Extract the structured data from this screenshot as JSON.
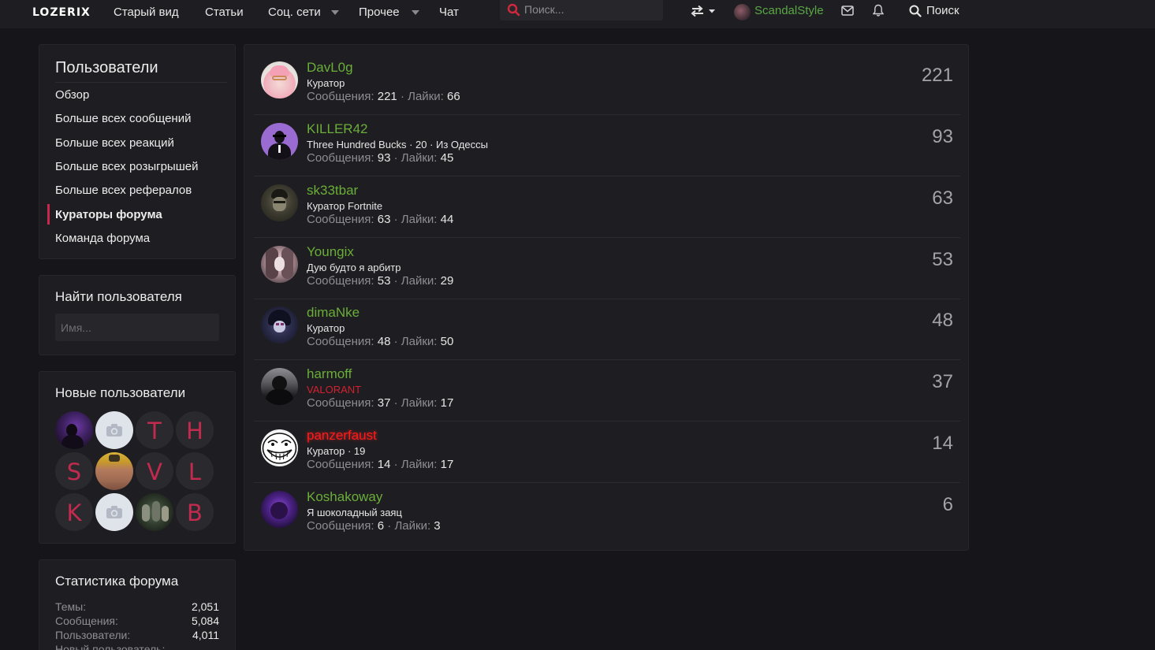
{
  "header": {
    "logo": "LOZERIX",
    "nav": [
      {
        "label": "Старый вид"
      },
      {
        "label": "Статьи"
      },
      {
        "label": "Соц. сети"
      },
      {
        "label": "Прочее"
      },
      {
        "label": "Чат"
      }
    ],
    "search_placeholder": "Поиск...",
    "username": "ScandalStyle",
    "search_button": "Поиск"
  },
  "colors": {
    "accent": "#c9284c",
    "username_green": "#6aae38",
    "search_icon_red": "#d0283f",
    "background": "#16161a",
    "panel": "#1e1e22"
  },
  "sidebar": {
    "members": {
      "title": "Пользователи",
      "items": [
        {
          "label": "Обзор"
        },
        {
          "label": "Больше всех сообщений"
        },
        {
          "label": "Больше всех реакций"
        },
        {
          "label": "Больше всех розыгрышей"
        },
        {
          "label": "Больше всех рефералов"
        },
        {
          "label": "Кураторы форума"
        },
        {
          "label": "Команда форума"
        }
      ],
      "active_item": "Кураторы форума"
    },
    "find": {
      "title": "Найти пользователя",
      "placeholder": "Имя..."
    },
    "new_users": {
      "title": "Новые пользователи",
      "letters": [
        "T",
        "H",
        "S",
        "V",
        "L",
        "K",
        "B"
      ]
    },
    "stats": {
      "title": "Статистика форума",
      "rows": [
        {
          "label": "Темы:",
          "value": "2,051"
        },
        {
          "label": "Сообщения:",
          "value": "5,084"
        },
        {
          "label": "Пользователи:",
          "value": "4,011"
        },
        {
          "label": "Новый пользователь:",
          "value": ""
        }
      ]
    }
  },
  "labels": {
    "messages": "Сообщения:",
    "likes": "Лайки:"
  },
  "curators": [
    {
      "name": "DavL0g",
      "title": "Куратор",
      "messages": "221",
      "likes": "66",
      "count": "221"
    },
    {
      "name": "KILLER42",
      "title": "Three Hundred Bucks · 20 · Из Одессы",
      "messages": "93",
      "likes": "45",
      "count": "93"
    },
    {
      "name": "sk33tbar",
      "title": "Куратор Fortnite",
      "messages": "63",
      "likes": "44",
      "count": "63"
    },
    {
      "name": "Youngix",
      "title": "Дую будто я арбитр",
      "messages": "53",
      "likes": "29",
      "count": "53"
    },
    {
      "name": "dimaNke",
      "title": "Куратор",
      "messages": "48",
      "likes": "50",
      "count": "48"
    },
    {
      "name": "harmoff",
      "title": "VALORANT",
      "messages": "37",
      "likes": "17",
      "count": "37"
    },
    {
      "name": "panzerfaust",
      "title": "Куратор · 19",
      "messages": "14",
      "likes": "17",
      "count": "14"
    },
    {
      "name": "Koshakoway",
      "title": "Я шоколадный заяц",
      "messages": "6",
      "likes": "3",
      "count": "6"
    }
  ]
}
